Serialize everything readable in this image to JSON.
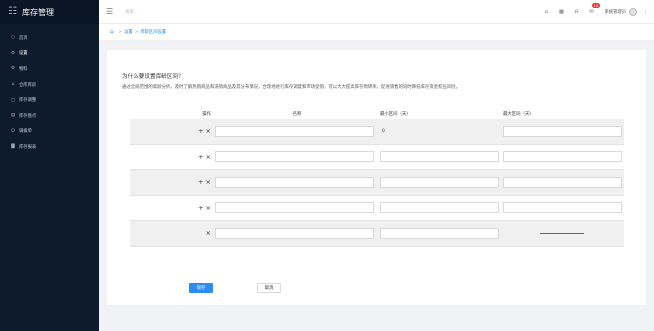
{
  "brand": {
    "title": "库存管理",
    "icon": "grid-icon"
  },
  "sidebar": {
    "items": [
      {
        "label": "首页",
        "icon": "home-icon",
        "active": false
      },
      {
        "label": "设置",
        "icon": "gear-icon",
        "active": true
      },
      {
        "label": "物料",
        "icon": "box-icon",
        "active": false
      },
      {
        "label": "仓库库房",
        "icon": "warehouse-icon",
        "active": false
      },
      {
        "label": "库存调整",
        "icon": "adjust-icon",
        "active": false
      },
      {
        "label": "库存盘点",
        "icon": "clipboard-icon",
        "active": false
      },
      {
        "label": "调拨单",
        "icon": "transfer-icon",
        "active": false
      },
      {
        "label": "库存报表",
        "icon": "chart-icon",
        "active": false
      }
    ]
  },
  "topbar": {
    "search_placeholder": "搜索...",
    "message_badge": "10",
    "user_name": "系统管理员",
    "icons": [
      "bell-outline-icon",
      "apps-icon",
      "notification-icon",
      "message-icon",
      "more-icon"
    ]
  },
  "breadcrumb": {
    "home_icon": "home-icon",
    "items": [
      "设置",
      "库龄区间设置"
    ]
  },
  "main": {
    "question": "为什么要设置库龄区间？",
    "description": "通过全局范围的库龄分析，及时了解热销商品和滞销商品及其分布情况，合理地进行库存调度和市场促销，可以大大提高库存周转率，促进销售的同时降低库存资金积压风险。"
  },
  "table": {
    "headers": {
      "op": "操作",
      "name": "名称",
      "min": "最小区间（天）",
      "max": "最大区间（天）"
    },
    "rows": [
      {
        "ops": "+ ×",
        "name": "",
        "min": "0",
        "min_static": true,
        "max": "",
        "max_dash": false
      },
      {
        "ops": "+ ×",
        "name": "",
        "min": "",
        "min_static": false,
        "max": "",
        "max_dash": false
      },
      {
        "ops": "+ ×",
        "name": "",
        "min": "",
        "min_static": false,
        "max": "",
        "max_dash": false
      },
      {
        "ops": "+ ×",
        "name": "",
        "min": "",
        "min_static": false,
        "max": "",
        "max_dash": false
      },
      {
        "ops": "×",
        "name": "",
        "min": "",
        "min_static": false,
        "max": "",
        "max_dash": true
      }
    ]
  },
  "actions": {
    "save_label": "保存",
    "cancel_label": "取消"
  },
  "colors": {
    "sidebar_bg": "#0e1b2d",
    "accent": "#2d8cf0",
    "badge": "#e53935"
  }
}
